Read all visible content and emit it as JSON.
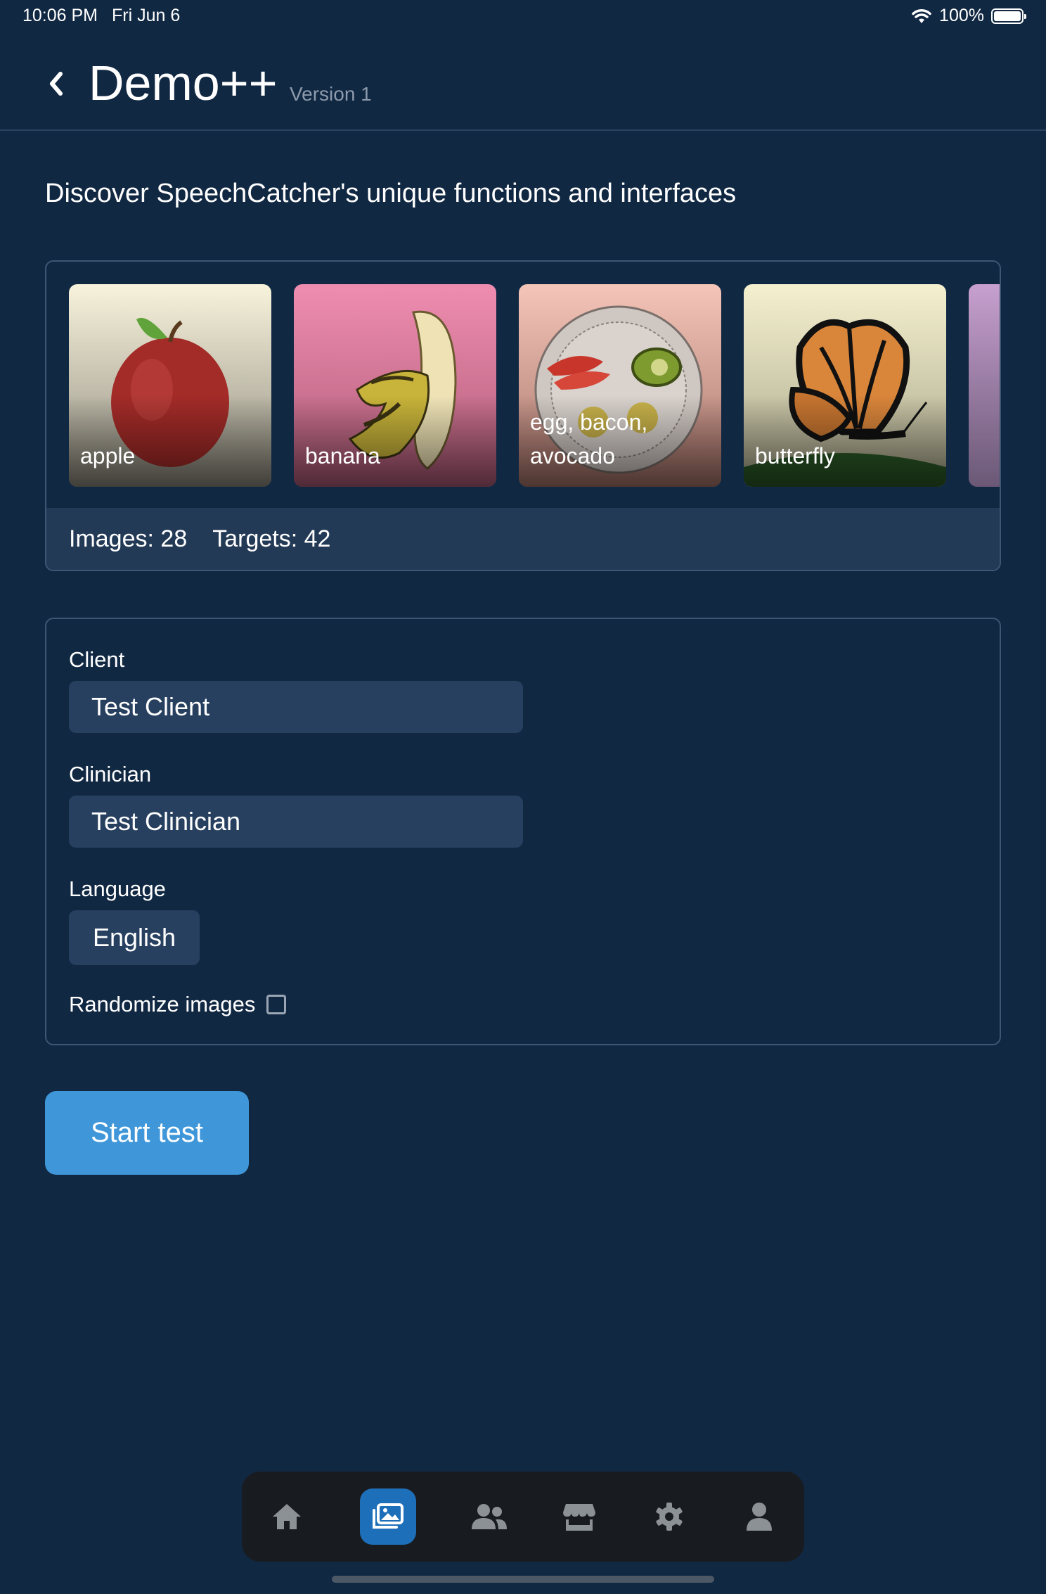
{
  "status_bar": {
    "time": "10:06 PM",
    "date": "Fri Jun 6",
    "battery": "100%",
    "icons": [
      "wifi-icon",
      "battery-icon"
    ]
  },
  "header": {
    "title": "Demo++",
    "version": "Version 1",
    "back_icon": "chevron-left-icon"
  },
  "subtitle": "Discover SpeechCatcher's unique functions and interfaces",
  "gallery": {
    "tiles": [
      {
        "label": "apple"
      },
      {
        "label": "banana"
      },
      {
        "label": "egg, bacon, avocado"
      },
      {
        "label": "butterfly"
      }
    ],
    "images_label": "Images:",
    "images_count": "28",
    "targets_label": "Targets:",
    "targets_count": "42"
  },
  "form": {
    "client_label": "Client",
    "client_value": "Test Client",
    "clinician_label": "Clinician",
    "clinician_value": "Test Clinician",
    "language_label": "Language",
    "language_value": "English",
    "randomize_label": "Randomize images",
    "randomize_checked": false
  },
  "start_button": "Start test",
  "tab_bar": {
    "tabs": [
      {
        "icon": "home-icon",
        "active": false
      },
      {
        "icon": "images-icon",
        "active": true
      },
      {
        "icon": "users-icon",
        "active": false
      },
      {
        "icon": "store-icon",
        "active": false
      },
      {
        "icon": "gear-icon",
        "active": false
      },
      {
        "icon": "user-icon",
        "active": false
      }
    ]
  },
  "colors": {
    "background": "#112843",
    "accent": "#3f97d9",
    "active_tab": "#1e6fb9",
    "field": "#27405f"
  }
}
